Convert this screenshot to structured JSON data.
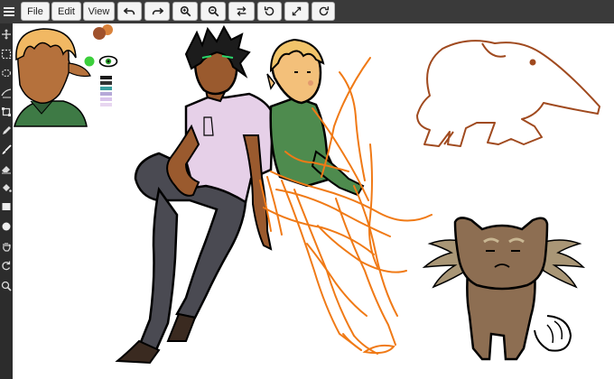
{
  "menu": {
    "file_label": "File",
    "edit_label": "Edit",
    "view_label": "View"
  },
  "toolbar": {
    "icons": [
      "undo-icon",
      "redo-icon",
      "zoom-in-icon",
      "zoom-out-icon",
      "flip-icon",
      "rotate-icon",
      "fullscreen-icon",
      "refresh-icon"
    ]
  },
  "tools": [
    "move-icon",
    "marquee-icon",
    "lasso-icon",
    "transform-icon",
    "crop-icon",
    "pencil-icon",
    "brush-icon",
    "eraser-icon",
    "fill-icon",
    "rectangle-icon",
    "ellipse-icon",
    "hand-icon",
    "rotate-view-icon",
    "zoom-icon"
  ],
  "colors": {
    "toolbar_bg": "#3a3a3a",
    "sidebar_bg": "#2c2c2c",
    "sketch_orange": "#f07a16",
    "anteater_brown": "#a04a1f",
    "swatch_primary": "#a0522d",
    "swatch_secondary": "#d9823b"
  },
  "layers": {
    "visible_icon": "eye-icon",
    "status_color": "#3ccf3c"
  }
}
